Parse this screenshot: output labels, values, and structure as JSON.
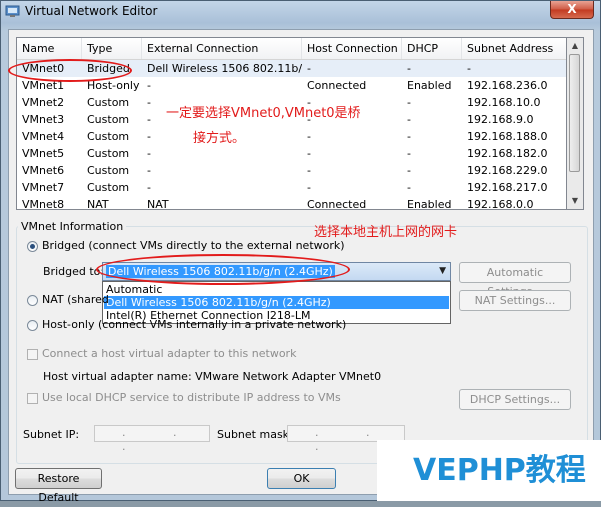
{
  "window": {
    "title": "Virtual Network Editor",
    "close_glyph": "X",
    "icon": "network-editor-icon"
  },
  "table": {
    "columns": [
      "Name",
      "Type",
      "External Connection",
      "Host Connection",
      "DHCP",
      "Subnet Address"
    ],
    "rows": [
      {
        "name": "VMnet0",
        "type": "Bridged",
        "external": "Dell Wireless 1506 802.11b/...",
        "host": "-",
        "dhcp": "-",
        "subnet": "-"
      },
      {
        "name": "VMnet1",
        "type": "Host-only",
        "external": "-",
        "host": "Connected",
        "dhcp": "Enabled",
        "subnet": "192.168.236.0"
      },
      {
        "name": "VMnet2",
        "type": "Custom",
        "external": "-",
        "host": "-",
        "dhcp": "-",
        "subnet": "192.168.10.0"
      },
      {
        "name": "VMnet3",
        "type": "Custom",
        "external": "-",
        "host": "-",
        "dhcp": "-",
        "subnet": "192.168.9.0"
      },
      {
        "name": "VMnet4",
        "type": "Custom",
        "external": "-",
        "host": "-",
        "dhcp": "-",
        "subnet": "192.168.188.0"
      },
      {
        "name": "VMnet5",
        "type": "Custom",
        "external": "-",
        "host": "-",
        "dhcp": "-",
        "subnet": "192.168.182.0"
      },
      {
        "name": "VMnet6",
        "type": "Custom",
        "external": "-",
        "host": "-",
        "dhcp": "-",
        "subnet": "192.168.229.0"
      },
      {
        "name": "VMnet7",
        "type": "Custom",
        "external": "-",
        "host": "-",
        "dhcp": "-",
        "subnet": "192.168.217.0"
      },
      {
        "name": "VMnet8",
        "type": "NAT",
        "external": "NAT",
        "host": "Connected",
        "dhcp": "Enabled",
        "subnet": "192.168.0.0"
      }
    ]
  },
  "vmnet_info": {
    "group_title": "VMnet Information",
    "bridged_label": "Bridged (connect VMs directly to the external network)",
    "bridged_to_label": "Bridged to:",
    "bridged_to_value": "Dell Wireless 1506 802.11b/g/n (2.4GHz)",
    "dropdown_options": [
      "Automatic",
      "Dell Wireless 1506 802.11b/g/n (2.4GHz)",
      "Intel(R) Ethernet Connection I218-LM"
    ],
    "automatic_settings_button": "Automatic Settings...",
    "nat_label": "NAT (shared",
    "nat_settings_button": "NAT Settings...",
    "hostonly_label": "Host-only (connect VMs internally in a private network)",
    "connect_adapter_label": "Connect a host virtual adapter to this network",
    "adapter_name_label": "Host virtual adapter name: VMware Network Adapter VMnet0",
    "dhcp_label": "Use local DHCP service to distribute IP address to VMs",
    "dhcp_settings_button": "DHCP Settings...",
    "subnet_ip_label": "Subnet IP:",
    "subnet_mask_label": "Subnet mask:",
    "ip_placeholder": ". . ."
  },
  "buttons": {
    "restore_default": "Restore Default",
    "ok": "OK"
  },
  "annotations": {
    "note1_line1": "一定要选择VMnet0,VMnet0是桥",
    "note1_line2": "接方式。",
    "note2": "选择本地主机上网的网卡",
    "color": "#e21b1b"
  },
  "watermark": "VEPHP教程",
  "colors": {
    "selection": "#3399ff",
    "watermark": "#1f8fd6",
    "annotation": "#e21b1b"
  }
}
